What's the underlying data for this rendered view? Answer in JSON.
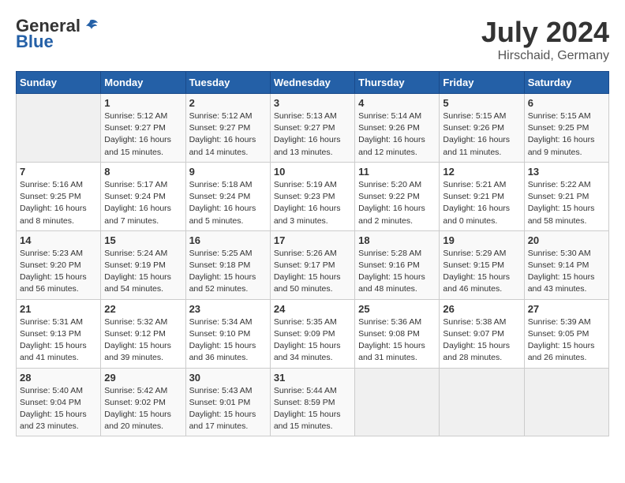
{
  "header": {
    "logo_general": "General",
    "logo_blue": "Blue",
    "month": "July 2024",
    "location": "Hirschaid, Germany"
  },
  "columns": [
    "Sunday",
    "Monday",
    "Tuesday",
    "Wednesday",
    "Thursday",
    "Friday",
    "Saturday"
  ],
  "weeks": [
    [
      {
        "day": "",
        "sunrise": "",
        "sunset": "",
        "daylight": ""
      },
      {
        "day": "1",
        "sunrise": "Sunrise: 5:12 AM",
        "sunset": "Sunset: 9:27 PM",
        "daylight": "Daylight: 16 hours and 15 minutes."
      },
      {
        "day": "2",
        "sunrise": "Sunrise: 5:12 AM",
        "sunset": "Sunset: 9:27 PM",
        "daylight": "Daylight: 16 hours and 14 minutes."
      },
      {
        "day": "3",
        "sunrise": "Sunrise: 5:13 AM",
        "sunset": "Sunset: 9:27 PM",
        "daylight": "Daylight: 16 hours and 13 minutes."
      },
      {
        "day": "4",
        "sunrise": "Sunrise: 5:14 AM",
        "sunset": "Sunset: 9:26 PM",
        "daylight": "Daylight: 16 hours and 12 minutes."
      },
      {
        "day": "5",
        "sunrise": "Sunrise: 5:15 AM",
        "sunset": "Sunset: 9:26 PM",
        "daylight": "Daylight: 16 hours and 11 minutes."
      },
      {
        "day": "6",
        "sunrise": "Sunrise: 5:15 AM",
        "sunset": "Sunset: 9:25 PM",
        "daylight": "Daylight: 16 hours and 9 minutes."
      }
    ],
    [
      {
        "day": "7",
        "sunrise": "Sunrise: 5:16 AM",
        "sunset": "Sunset: 9:25 PM",
        "daylight": "Daylight: 16 hours and 8 minutes."
      },
      {
        "day": "8",
        "sunrise": "Sunrise: 5:17 AM",
        "sunset": "Sunset: 9:24 PM",
        "daylight": "Daylight: 16 hours and 7 minutes."
      },
      {
        "day": "9",
        "sunrise": "Sunrise: 5:18 AM",
        "sunset": "Sunset: 9:24 PM",
        "daylight": "Daylight: 16 hours and 5 minutes."
      },
      {
        "day": "10",
        "sunrise": "Sunrise: 5:19 AM",
        "sunset": "Sunset: 9:23 PM",
        "daylight": "Daylight: 16 hours and 3 minutes."
      },
      {
        "day": "11",
        "sunrise": "Sunrise: 5:20 AM",
        "sunset": "Sunset: 9:22 PM",
        "daylight": "Daylight: 16 hours and 2 minutes."
      },
      {
        "day": "12",
        "sunrise": "Sunrise: 5:21 AM",
        "sunset": "Sunset: 9:21 PM",
        "daylight": "Daylight: 16 hours and 0 minutes."
      },
      {
        "day": "13",
        "sunrise": "Sunrise: 5:22 AM",
        "sunset": "Sunset: 9:21 PM",
        "daylight": "Daylight: 15 hours and 58 minutes."
      }
    ],
    [
      {
        "day": "14",
        "sunrise": "Sunrise: 5:23 AM",
        "sunset": "Sunset: 9:20 PM",
        "daylight": "Daylight: 15 hours and 56 minutes."
      },
      {
        "day": "15",
        "sunrise": "Sunrise: 5:24 AM",
        "sunset": "Sunset: 9:19 PM",
        "daylight": "Daylight: 15 hours and 54 minutes."
      },
      {
        "day": "16",
        "sunrise": "Sunrise: 5:25 AM",
        "sunset": "Sunset: 9:18 PM",
        "daylight": "Daylight: 15 hours and 52 minutes."
      },
      {
        "day": "17",
        "sunrise": "Sunrise: 5:26 AM",
        "sunset": "Sunset: 9:17 PM",
        "daylight": "Daylight: 15 hours and 50 minutes."
      },
      {
        "day": "18",
        "sunrise": "Sunrise: 5:28 AM",
        "sunset": "Sunset: 9:16 PM",
        "daylight": "Daylight: 15 hours and 48 minutes."
      },
      {
        "day": "19",
        "sunrise": "Sunrise: 5:29 AM",
        "sunset": "Sunset: 9:15 PM",
        "daylight": "Daylight: 15 hours and 46 minutes."
      },
      {
        "day": "20",
        "sunrise": "Sunrise: 5:30 AM",
        "sunset": "Sunset: 9:14 PM",
        "daylight": "Daylight: 15 hours and 43 minutes."
      }
    ],
    [
      {
        "day": "21",
        "sunrise": "Sunrise: 5:31 AM",
        "sunset": "Sunset: 9:13 PM",
        "daylight": "Daylight: 15 hours and 41 minutes."
      },
      {
        "day": "22",
        "sunrise": "Sunrise: 5:32 AM",
        "sunset": "Sunset: 9:12 PM",
        "daylight": "Daylight: 15 hours and 39 minutes."
      },
      {
        "day": "23",
        "sunrise": "Sunrise: 5:34 AM",
        "sunset": "Sunset: 9:10 PM",
        "daylight": "Daylight: 15 hours and 36 minutes."
      },
      {
        "day": "24",
        "sunrise": "Sunrise: 5:35 AM",
        "sunset": "Sunset: 9:09 PM",
        "daylight": "Daylight: 15 hours and 34 minutes."
      },
      {
        "day": "25",
        "sunrise": "Sunrise: 5:36 AM",
        "sunset": "Sunset: 9:08 PM",
        "daylight": "Daylight: 15 hours and 31 minutes."
      },
      {
        "day": "26",
        "sunrise": "Sunrise: 5:38 AM",
        "sunset": "Sunset: 9:07 PM",
        "daylight": "Daylight: 15 hours and 28 minutes."
      },
      {
        "day": "27",
        "sunrise": "Sunrise: 5:39 AM",
        "sunset": "Sunset: 9:05 PM",
        "daylight": "Daylight: 15 hours and 26 minutes."
      }
    ],
    [
      {
        "day": "28",
        "sunrise": "Sunrise: 5:40 AM",
        "sunset": "Sunset: 9:04 PM",
        "daylight": "Daylight: 15 hours and 23 minutes."
      },
      {
        "day": "29",
        "sunrise": "Sunrise: 5:42 AM",
        "sunset": "Sunset: 9:02 PM",
        "daylight": "Daylight: 15 hours and 20 minutes."
      },
      {
        "day": "30",
        "sunrise": "Sunrise: 5:43 AM",
        "sunset": "Sunset: 9:01 PM",
        "daylight": "Daylight: 15 hours and 17 minutes."
      },
      {
        "day": "31",
        "sunrise": "Sunrise: 5:44 AM",
        "sunset": "Sunset: 8:59 PM",
        "daylight": "Daylight: 15 hours and 15 minutes."
      },
      {
        "day": "",
        "sunrise": "",
        "sunset": "",
        "daylight": ""
      },
      {
        "day": "",
        "sunrise": "",
        "sunset": "",
        "daylight": ""
      },
      {
        "day": "",
        "sunrise": "",
        "sunset": "",
        "daylight": ""
      }
    ]
  ]
}
